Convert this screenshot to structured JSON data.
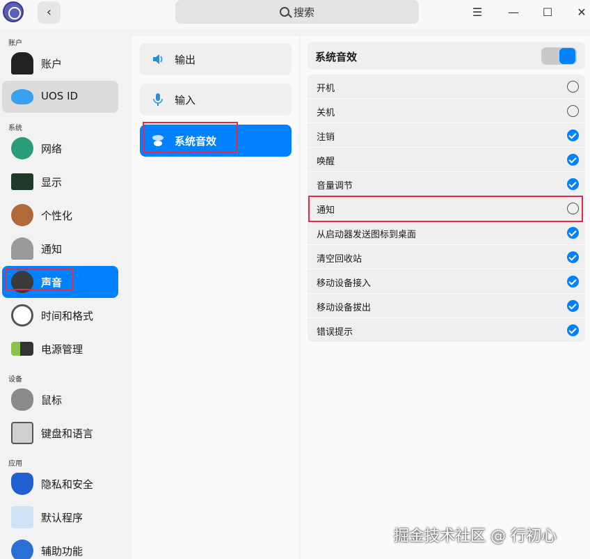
{
  "titlebar": {
    "back_glyph": "‹",
    "search_placeholder": "搜索",
    "menu_glyph": "☰",
    "minimize_glyph": "—",
    "maximize_glyph": "☐",
    "close_glyph": "✕"
  },
  "sidebar": {
    "groups": {
      "account": "账户",
      "system": "系统",
      "device": "设备",
      "app": "应用"
    },
    "items": [
      {
        "label": "账户",
        "icon": "user-icon"
      },
      {
        "label": "UOS ID",
        "icon": "cloud-icon"
      },
      {
        "label": "网络",
        "icon": "network-icon"
      },
      {
        "label": "显示",
        "icon": "display-icon"
      },
      {
        "label": "个性化",
        "icon": "palette-icon"
      },
      {
        "label": "通知",
        "icon": "bell-icon"
      },
      {
        "label": "声音",
        "icon": "speaker-icon"
      },
      {
        "label": "时间和格式",
        "icon": "clock-icon"
      },
      {
        "label": "电源管理",
        "icon": "battery-icon"
      },
      {
        "label": "鼠标",
        "icon": "mouse-icon"
      },
      {
        "label": "键盘和语言",
        "icon": "keyboard-icon"
      },
      {
        "label": "隐私和安全",
        "icon": "shield-icon"
      },
      {
        "label": "默认程序",
        "icon": "default-apps-icon"
      },
      {
        "label": "辅助功能",
        "icon": "accessibility-icon"
      }
    ]
  },
  "sound_menu": {
    "items": [
      {
        "label": "输出",
        "icon": "speaker-output-icon"
      },
      {
        "label": "输入",
        "icon": "microphone-icon"
      },
      {
        "label": "系统音效",
        "icon": "system-sound-icon"
      }
    ]
  },
  "system_effects": {
    "title": "系统音效",
    "enabled": true,
    "rows": [
      {
        "label": "开机",
        "checked": false
      },
      {
        "label": "关机",
        "checked": false
      },
      {
        "label": "注销",
        "checked": true
      },
      {
        "label": "唤醒",
        "checked": true
      },
      {
        "label": "音量调节",
        "checked": true
      },
      {
        "label": "通知",
        "checked": false
      },
      {
        "label": "从启动器发送图标到桌面",
        "checked": true
      },
      {
        "label": "清空回收站",
        "checked": true
      },
      {
        "label": "移动设备接入",
        "checked": true
      },
      {
        "label": "移动设备拔出",
        "checked": true
      },
      {
        "label": "错误提示",
        "checked": true
      }
    ]
  },
  "watermark": "掘金技术社区 @ 行初心",
  "colors": {
    "accent": "#0081ff",
    "highlight": "#e8274b"
  }
}
